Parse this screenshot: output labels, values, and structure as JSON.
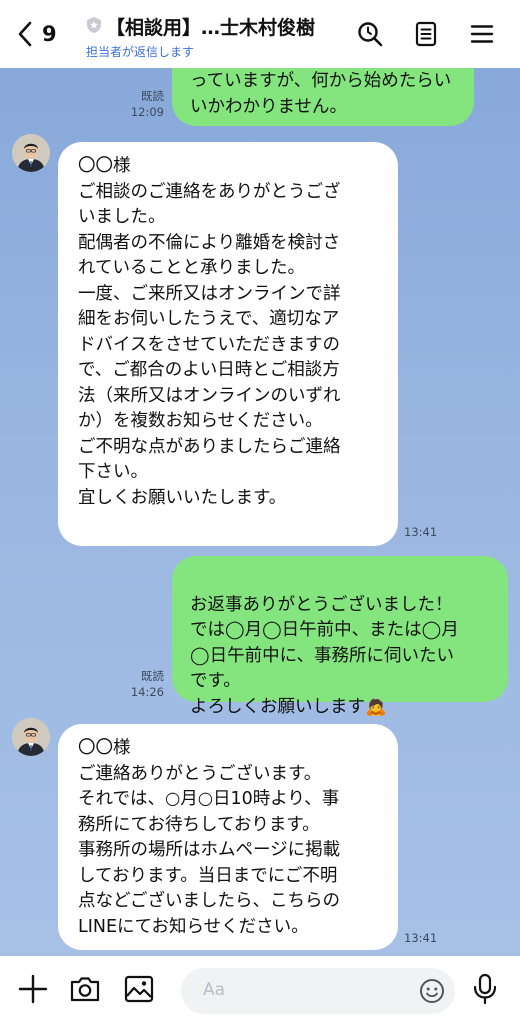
{
  "header": {
    "unread_count": "9",
    "title": "【相談用】…士木村俊樹",
    "subtitle": "担当者が返信します"
  },
  "messages": [
    {
      "side": "out",
      "text": "っていますが、何から始めたらい\nいかわかりません。",
      "read": "既読",
      "time": "12:09"
    },
    {
      "side": "in",
      "text": "〇〇様\nご相談のご連絡をありがとうござ\nいました。\n配偶者の不倫により離婚を検討さ\nれていることと承りました。\n一度、ご来所又はオンラインで詳\n細をお伺いしたうえで、適切なア\nドバイスをさせていただきますの\nで、ご都合のよい日時とご相談方\n法（来所又はオンラインのいずれ\nか）を複数お知らせください。\nご不明な点がありましたらご連絡\n下さい。\n宜しくお願いいたします。",
      "time": "13:41"
    },
    {
      "side": "out",
      "text": "お返事ありがとうございました！\nでは◯月◯日午前中、または◯月\n◯日午前中に、事務所に伺いたい\nです。\nよろしくお願いします",
      "emoji": "🙇",
      "read": "既読",
      "time": "14:26"
    },
    {
      "side": "in",
      "text": "〇〇様\nご連絡ありがとうございます。\nそれでは、○月○日10時より、事\n務所にてお待ちしております。\n事務所の場所はホムページに掲載\nしております。当日までにご不明\n点などございましたら、こちらの\nLINEにてお知らせください。",
      "time": "13:41"
    }
  ],
  "composer": {
    "placeholder": "Aa"
  },
  "icons": {
    "header": [
      "back-chevron-icon",
      "shield-icon",
      "search-icon",
      "notes-icon",
      "menu-icon"
    ],
    "footer": [
      "plus-icon",
      "camera-icon",
      "image-icon",
      "emoji-icon",
      "microphone-icon"
    ]
  },
  "colors": {
    "outgoing": "#84e57e",
    "incoming": "#ffffff",
    "background": "#8fb0de",
    "subtitle": "#3c6fd6"
  }
}
